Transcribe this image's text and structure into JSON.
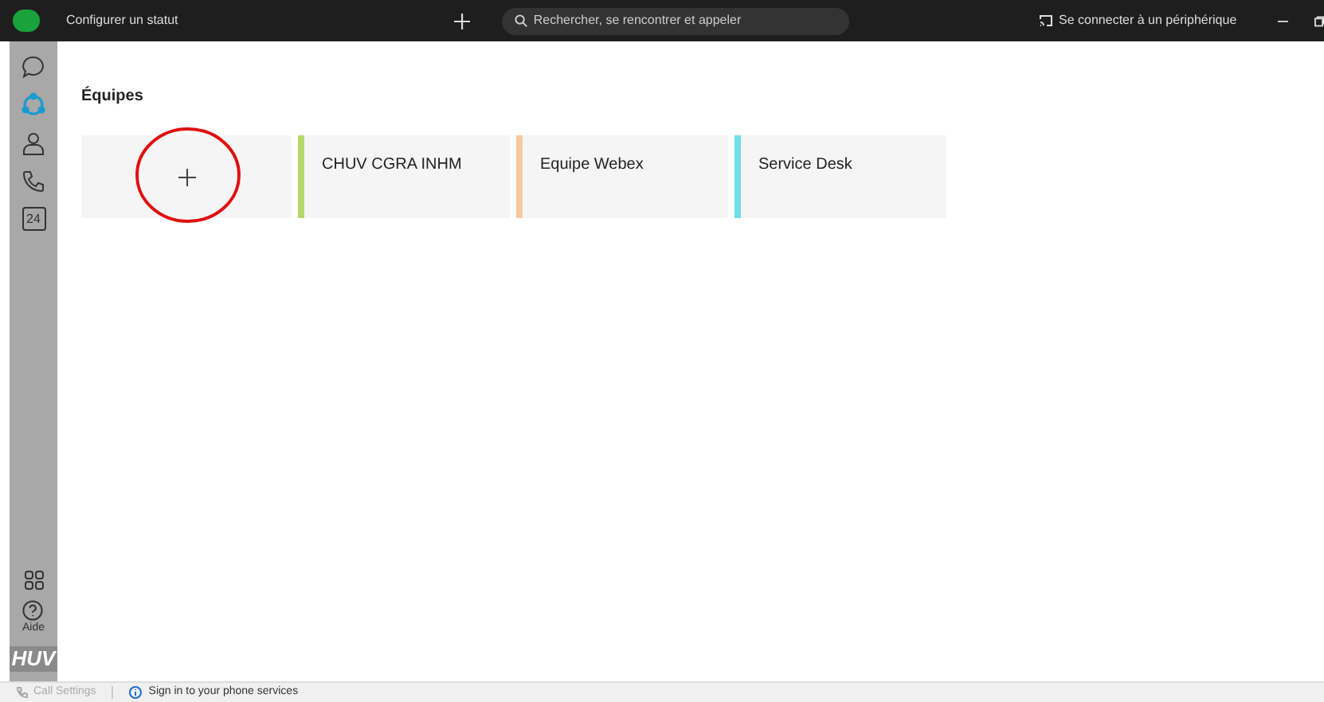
{
  "top_bar": {
    "status": "Configurer un statut",
    "search": {
      "placeholder": "Rechercher, se rencontrer et appeler"
    },
    "connect": "Se connecter à un périphérique"
  },
  "sidebar": {
    "items": [
      {
        "kind": "chat",
        "selected": false
      },
      {
        "kind": "teams",
        "selected": true
      },
      {
        "kind": "contacts",
        "selected": false
      },
      {
        "kind": "calls",
        "selected": false
      },
      {
        "kind": "calendar",
        "label": "24",
        "selected": false
      }
    ],
    "help": "Aide",
    "logo": "HUV"
  },
  "page": {
    "title": "Équipes",
    "teams": [
      {
        "name": "CHUV CGRA INHM",
        "color": "#b3d96a"
      },
      {
        "name": "Equipe Webex",
        "color": "#f8c9a0"
      },
      {
        "name": "Service Desk",
        "color": "#6fe0e8"
      }
    ]
  },
  "status_bar": {
    "call_settings": "Call Settings",
    "sign_in": "Sign in to your phone services"
  }
}
